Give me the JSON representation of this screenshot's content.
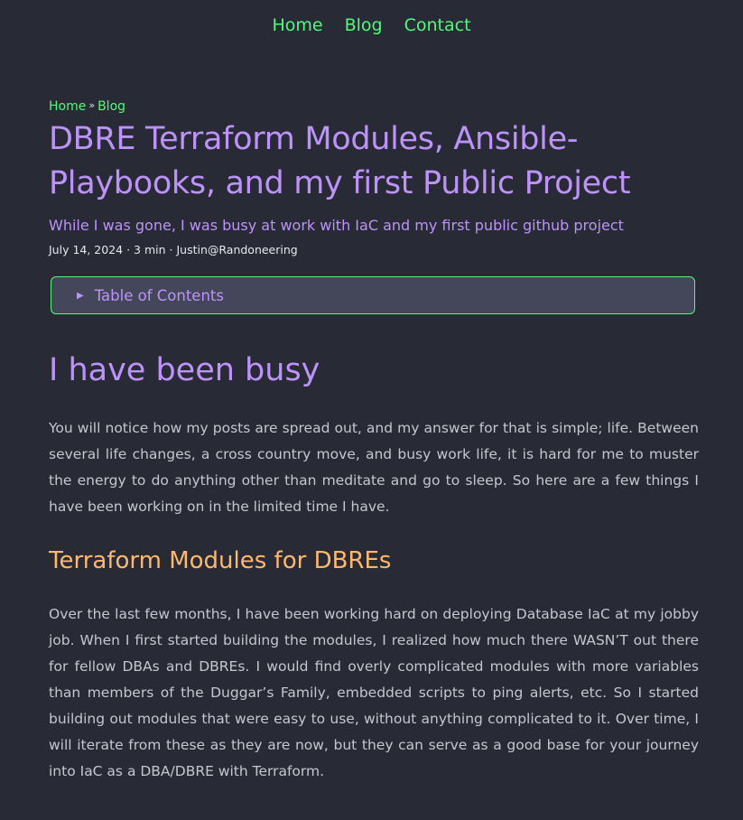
{
  "nav": {
    "items": [
      "Home",
      "Blog",
      "Contact"
    ]
  },
  "breadcrumb": {
    "home": "Home",
    "sep": "»",
    "blog": "Blog"
  },
  "post": {
    "title": "DBRE Terraform Modules, Ansible-Playbooks, and my first Public Project",
    "description": "While I was gone, I was busy at work with IaC and my first public github project",
    "meta": "July 14, 2024 · 3 min · Justin@Randoneering",
    "toc_label": "Table of Contents",
    "h2": "I have been busy",
    "p1": "You will notice how my posts are spread out, and my answer for that is simple; life. Between several life changes, a cross country move, and busy work life, it is hard for me to muster the energy to do anything other than meditate and go to sleep. So here are a few things I have been working on in the limited time I have.",
    "h3": "Terraform Modules for DBREs",
    "p2": "Over the last few months, I have been working hard on deploying Database IaC at my jobby job. When I first started building the modules, I realized how much there WASN’T out there for fellow DBAs and DBREs. I would find overly complicated modules with more variables than members of the Duggar’s Family, embedded scripts to ping alerts, etc. So I started building out modules that were easy to use, without anything complicated to it. Over time, I will iterate from these as they are now, but they can serve as a good base for your journey into IaC as a DBA/DBRE with Terraform."
  }
}
